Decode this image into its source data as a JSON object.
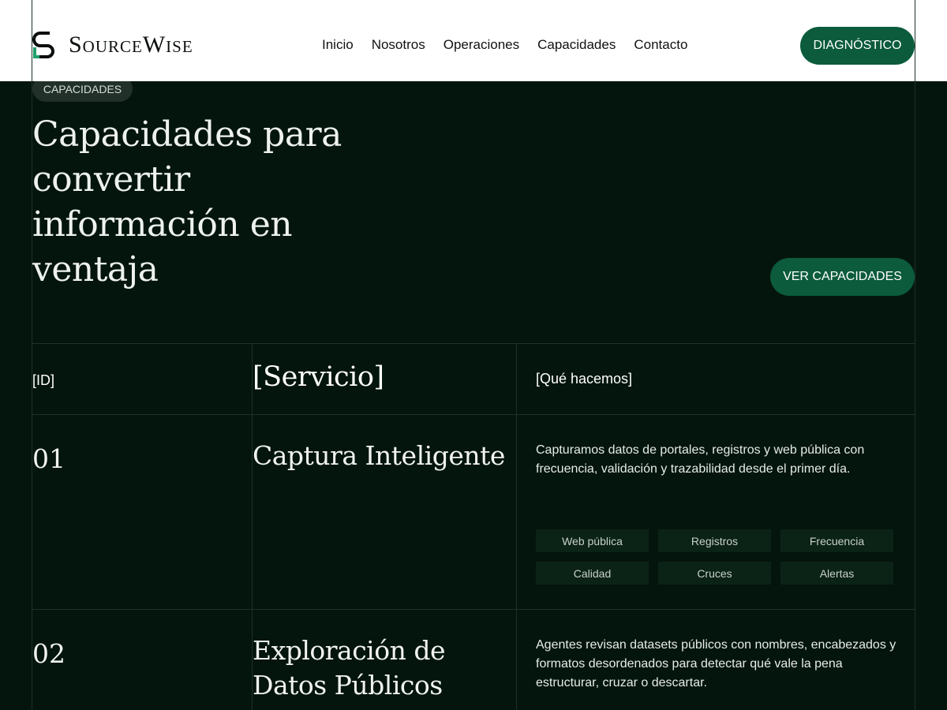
{
  "brand": {
    "name": "SourceWise",
    "logo_icon": "sourcewise-logo-mark"
  },
  "nav": {
    "items": [
      "Inicio",
      "Nosotros",
      "Operaciones",
      "Capacidades",
      "Contacto"
    ]
  },
  "header": {
    "cta_label": "DIAGNÓSTICO"
  },
  "hero": {
    "badge": "CAPACIDADES",
    "title": "Capacidades para convertir información en ventaja",
    "cta_label": "VER CAPACIDADES"
  },
  "table": {
    "headers": {
      "id": "[ID]",
      "service": "[Servicio]",
      "description": "[Qué hacemos]"
    },
    "rows": [
      {
        "id": "01",
        "service": "Captura Inteligente",
        "description": "Capturamos datos de portales, registros y web pública con frecuencia, validación y trazabilidad desde el primer día.",
        "tags": [
          "Web pública",
          "Registros",
          "Frecuencia",
          "Calidad",
          "Cruces",
          "Alertas"
        ]
      },
      {
        "id": "02",
        "service": "Exploración de Datos Públicos",
        "description": "Agentes revisan datasets públicos con nombres, encabezados y formatos desordenados para detectar qué vale la pena estructurar, cruzar o descartar."
      }
    ]
  },
  "colors": {
    "background": "#04150d",
    "accent": "#0b5b3c",
    "header_bg": "#ffffff",
    "tag_bg": "#0b2217"
  }
}
